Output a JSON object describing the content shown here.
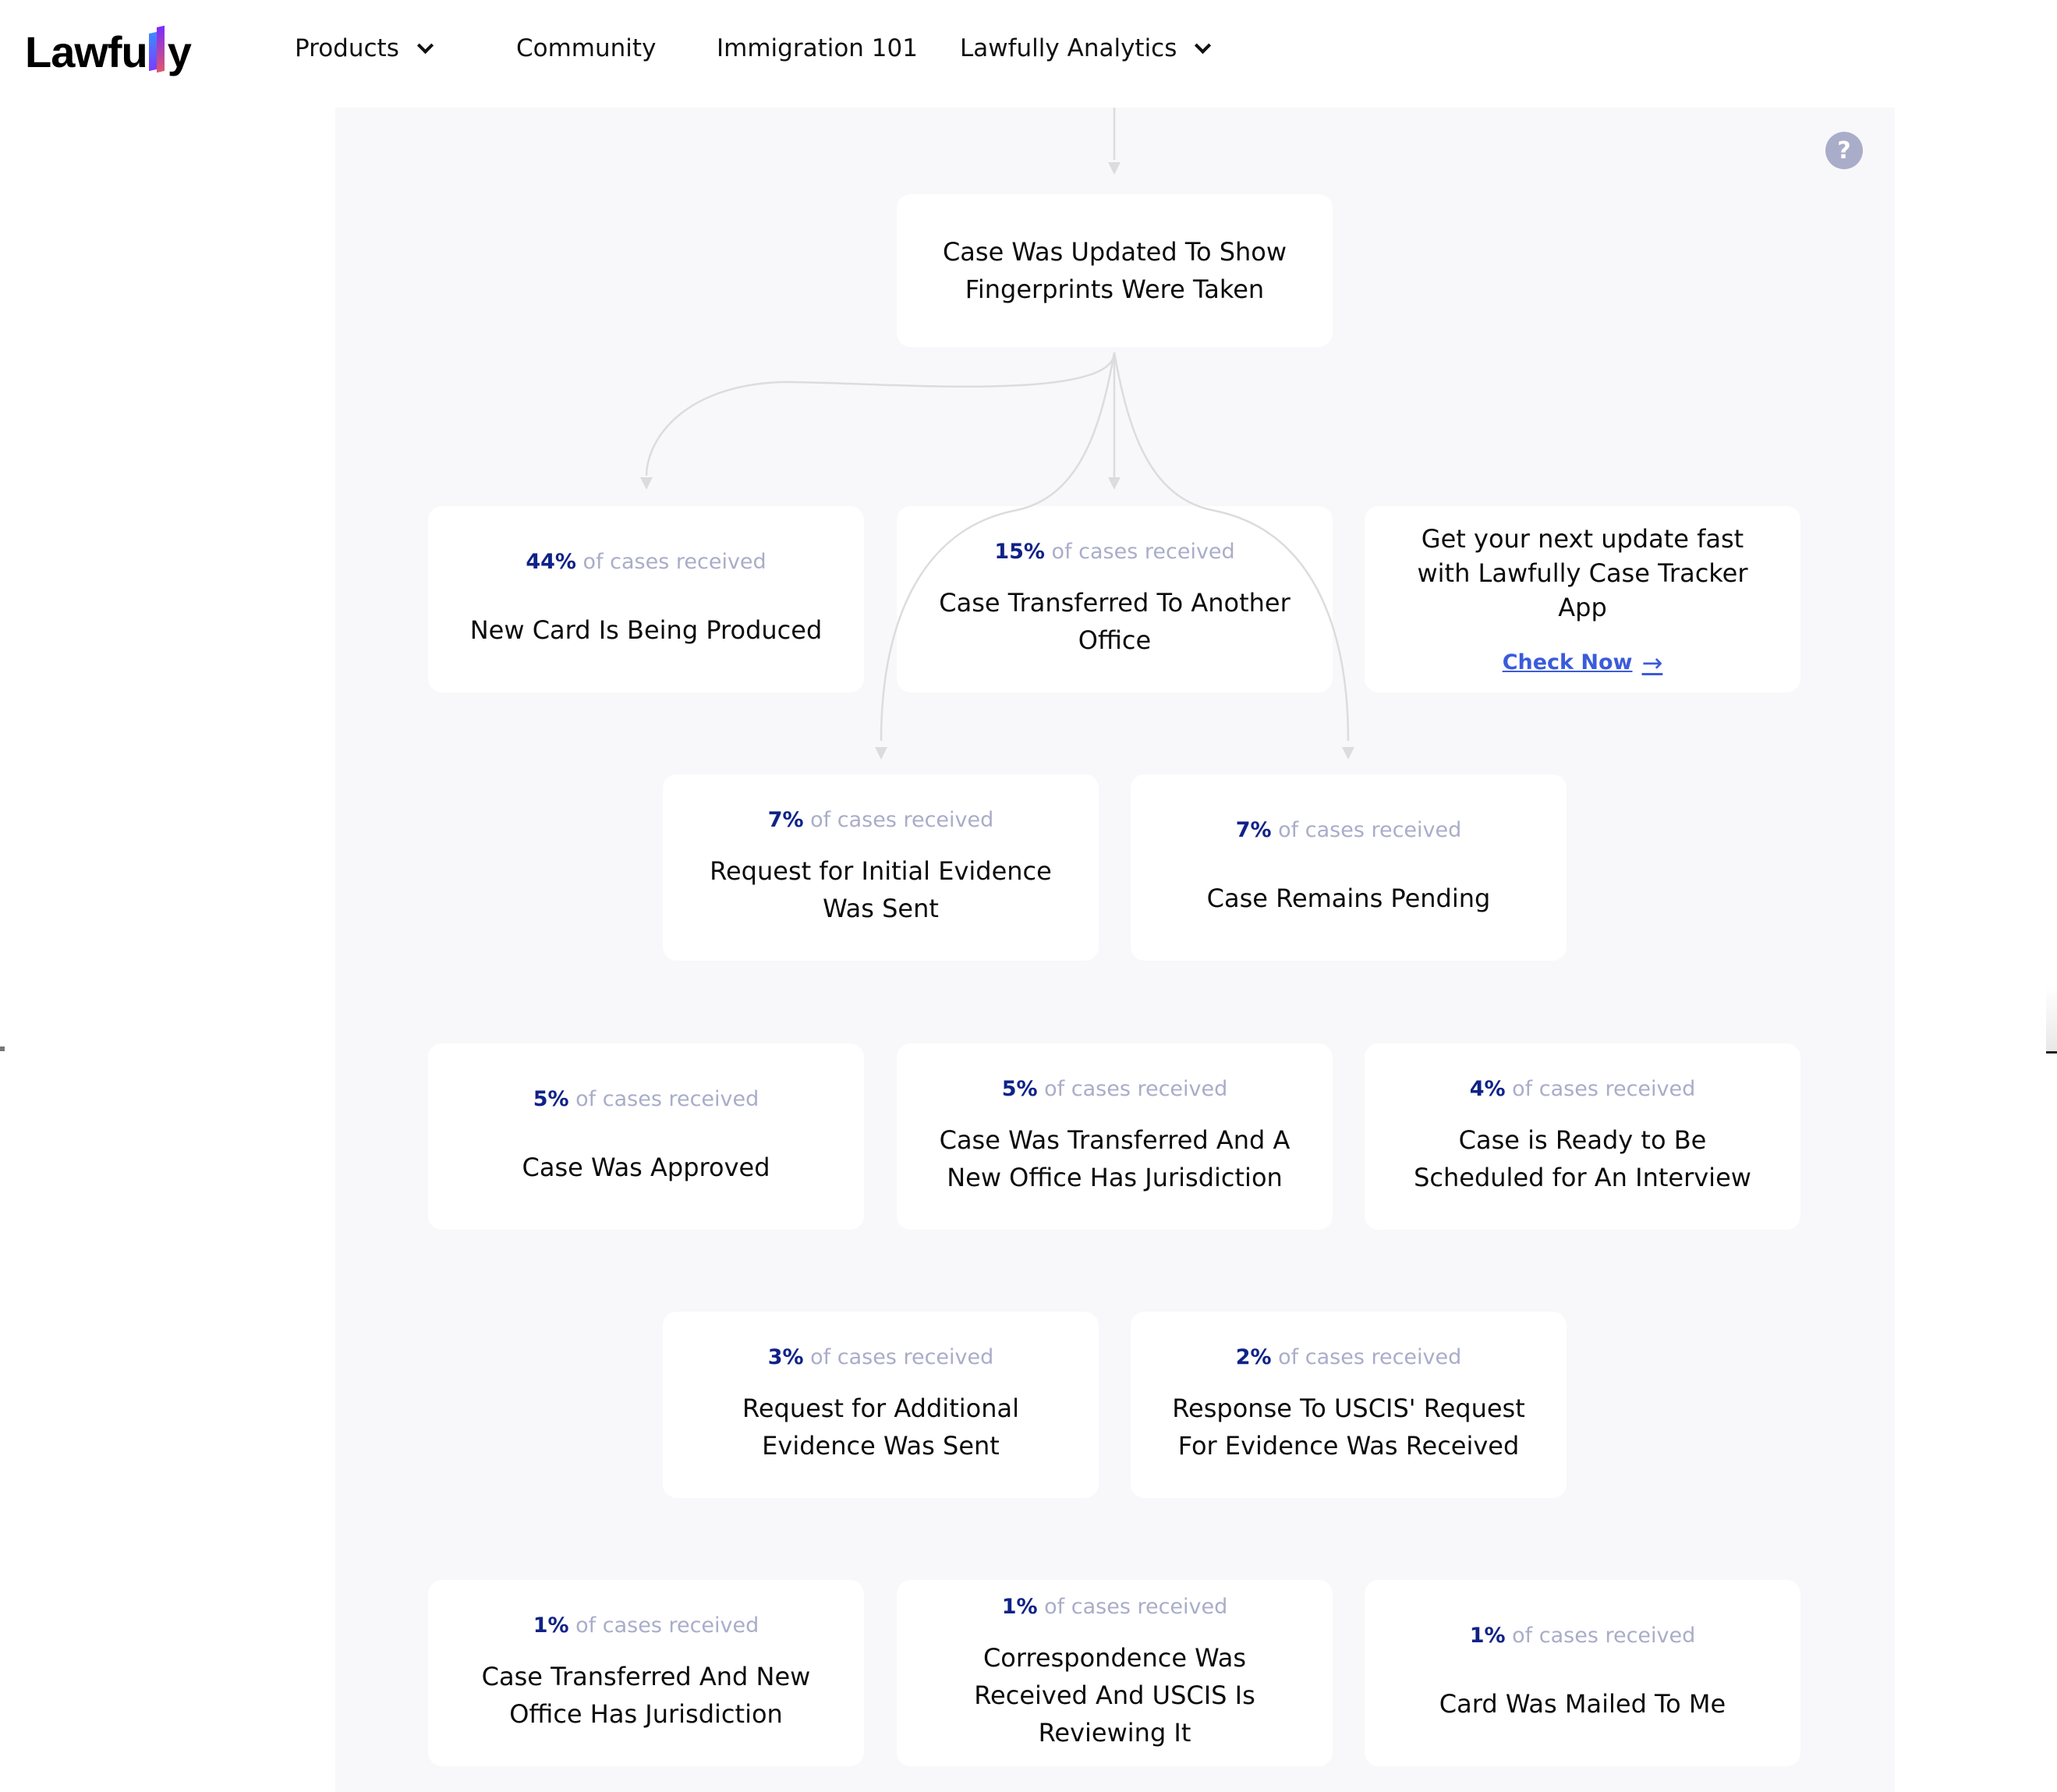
{
  "header": {
    "logo_text_left": "Lawfu",
    "logo_text_right": "y",
    "nav": [
      {
        "label": "Products",
        "has_dropdown": true
      },
      {
        "label": "Community",
        "has_dropdown": false
      },
      {
        "label": "Immigration 101",
        "has_dropdown": false
      },
      {
        "label": "Lawfully Analytics",
        "has_dropdown": true
      }
    ]
  },
  "help_icon": "?",
  "flow": {
    "current_status": "Case Was Updated To Show Fingerprints Were Taken",
    "stat_suffix": "of cases received",
    "next_statuses": [
      {
        "pct": "44%",
        "title": "New Card Is Being Produced"
      },
      {
        "pct": "15%",
        "title": "Case Transferred To Another Office"
      },
      {
        "pct": "7%",
        "title": "Request for Initial Evidence Was Sent"
      },
      {
        "pct": "7%",
        "title": "Case Remains Pending"
      },
      {
        "pct": "5%",
        "title": "Case Was Approved"
      },
      {
        "pct": "5%",
        "title": "Case Was Transferred And A New Office Has Jurisdiction"
      },
      {
        "pct": "4%",
        "title": "Case is Ready to Be Scheduled for An Interview"
      },
      {
        "pct": "3%",
        "title": "Request for Additional Evidence Was Sent"
      },
      {
        "pct": "2%",
        "title": "Response To USCIS' Request For Evidence Was Received"
      },
      {
        "pct": "1%",
        "title": "Case Transferred And New Office Has Jurisdiction"
      },
      {
        "pct": "1%",
        "title": "Correspondence Was Received And USCIS Is Reviewing It"
      },
      {
        "pct": "1%",
        "title": "Card Was Mailed To Me"
      }
    ]
  },
  "promo": {
    "title": "Get your next update fast with Lawfully Case Tracker App",
    "link_label": "Check Now",
    "link_icon": "→"
  },
  "colors": {
    "percent": "#0f2287",
    "muted": "#a9adc9",
    "link": "#3b5bdb",
    "panel_bg": "#f8f8fa",
    "connector": "#dcdcdc"
  }
}
